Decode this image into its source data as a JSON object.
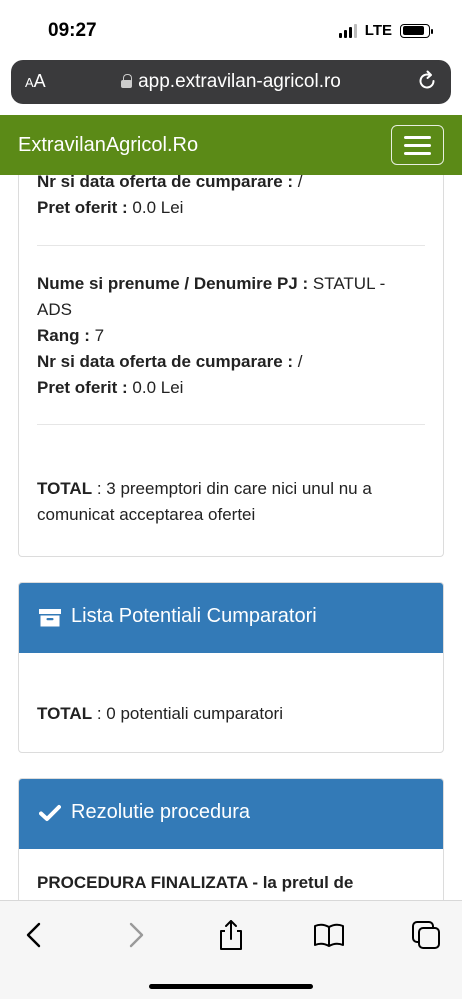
{
  "status": {
    "time": "09:27",
    "network": "LTE",
    "battery_level": 0.85
  },
  "browser": {
    "aa_small": "A",
    "aa_big": "A",
    "url": "app.extravilan-agricol.ro"
  },
  "navbar": {
    "brand": "ExtravilanAgricol.Ro"
  },
  "preemptors": {
    "partial_entry": {
      "offer_label": "Nr si data oferta de cumparare :",
      "offer_value": " /",
      "price_label": "Pret oferit :",
      "price_value": " 0.0 Lei"
    },
    "entry": {
      "name_label": "Nume si prenume / Denumire PJ :",
      "name_value": " STATUL -",
      "name_value_cont": "ADS",
      "rank_label": "Rang :",
      "rank_value": " 7",
      "offer_label": "Nr si data oferta de cumparare :",
      "offer_value": " /",
      "price_label": "Pret oferit :",
      "price_value": " 0.0 Lei"
    },
    "total_label": "TOTAL",
    "total_text_1": " : 3 preemptori din care nici unul nu a",
    "total_text_2": "comunicat acceptarea ofertei"
  },
  "buyers_panel": {
    "title": "Lista Potentiali Cumparatori",
    "icon": "archive-icon",
    "total_label": "TOTAL",
    "total_text": " : 0 potentiali cumparatori"
  },
  "resolution_panel": {
    "title": "Rezolutie procedura",
    "icon": "check-icon",
    "text": "PROCEDURA FINALIZATA - la pretul de"
  },
  "colors": {
    "navbar": "#5b8a17",
    "panel_heading": "#337ab7"
  }
}
